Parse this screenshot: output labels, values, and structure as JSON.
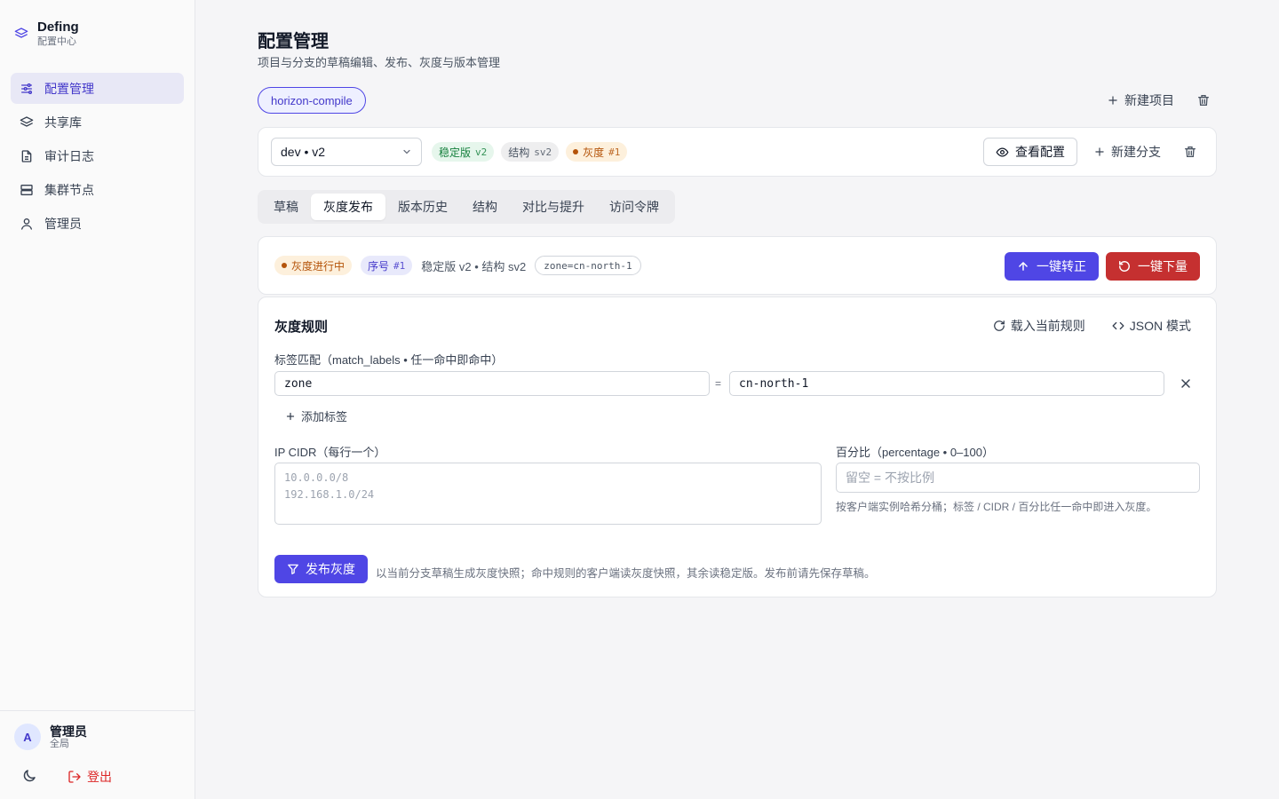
{
  "brand": {
    "name": "Defing",
    "subtitle": "配置中心"
  },
  "nav": [
    {
      "label": "配置管理",
      "icon": "sliders-icon",
      "active": true
    },
    {
      "label": "共享库",
      "icon": "layers-icon"
    },
    {
      "label": "审计日志",
      "icon": "file-icon"
    },
    {
      "label": "集群节点",
      "icon": "server-icon"
    },
    {
      "label": "管理员",
      "icon": "user-icon"
    }
  ],
  "user": {
    "avatar": "A",
    "name": "管理员",
    "scope": "全局",
    "logout": "登出"
  },
  "header": {
    "title": "配置管理",
    "subtitle": "项目与分支的草稿编辑、发布、灰度与版本管理"
  },
  "project": {
    "name": "horizon-compile",
    "new_label": "新建项目"
  },
  "branch": {
    "selected": "dev • v2",
    "stable_label": "稳定版",
    "stable_value": "v2",
    "schema_label": "结构",
    "schema_value": "sv2",
    "canary_label": "灰度",
    "canary_value": "#1",
    "view_label": "查看配置",
    "new_label": "新建分支"
  },
  "tabs": [
    "草稿",
    "灰度发布",
    "版本历史",
    "结构",
    "对比与提升",
    "访问令牌"
  ],
  "active_tab": 1,
  "status": {
    "state": "灰度进行中",
    "seq_label": "序号",
    "seq_value": "#1",
    "meta": "稳定版 v2 • 结构 sv2",
    "selector": "zone=cn-north-1",
    "promote_label": "一键转正",
    "rollback_label": "一键下量"
  },
  "rules": {
    "title": "灰度规则",
    "load_label": "载入当前规则",
    "json_label": "JSON 模式",
    "match_label": "标签匹配（match_labels • 任一命中即命中）",
    "tag_key": "zone",
    "eq": "=",
    "tag_value": "cn-north-1",
    "add_tag": "添加标签",
    "cidr_label": "IP CIDR（每行一个）",
    "cidr_placeholder_1": "10.0.0.0/8",
    "cidr_placeholder_2": "192.168.1.0/24",
    "pct_label": "百分比（percentage • 0–100）",
    "pct_placeholder": "留空 = 不按比例",
    "pct_hint": "按客户端实例哈希分桶；标签 / CIDR / 百分比任一命中即进入灰度。",
    "publish_label": "发布灰度",
    "publish_hint": "以当前分支草稿生成灰度快照；命中规则的客户端读灰度快照，其余读稳定版。发布前请先保存草稿。"
  },
  "colors": {
    "accent": "#4f46e5",
    "danger": "#c53030",
    "success": "#15803d",
    "warning": "#b45309"
  }
}
